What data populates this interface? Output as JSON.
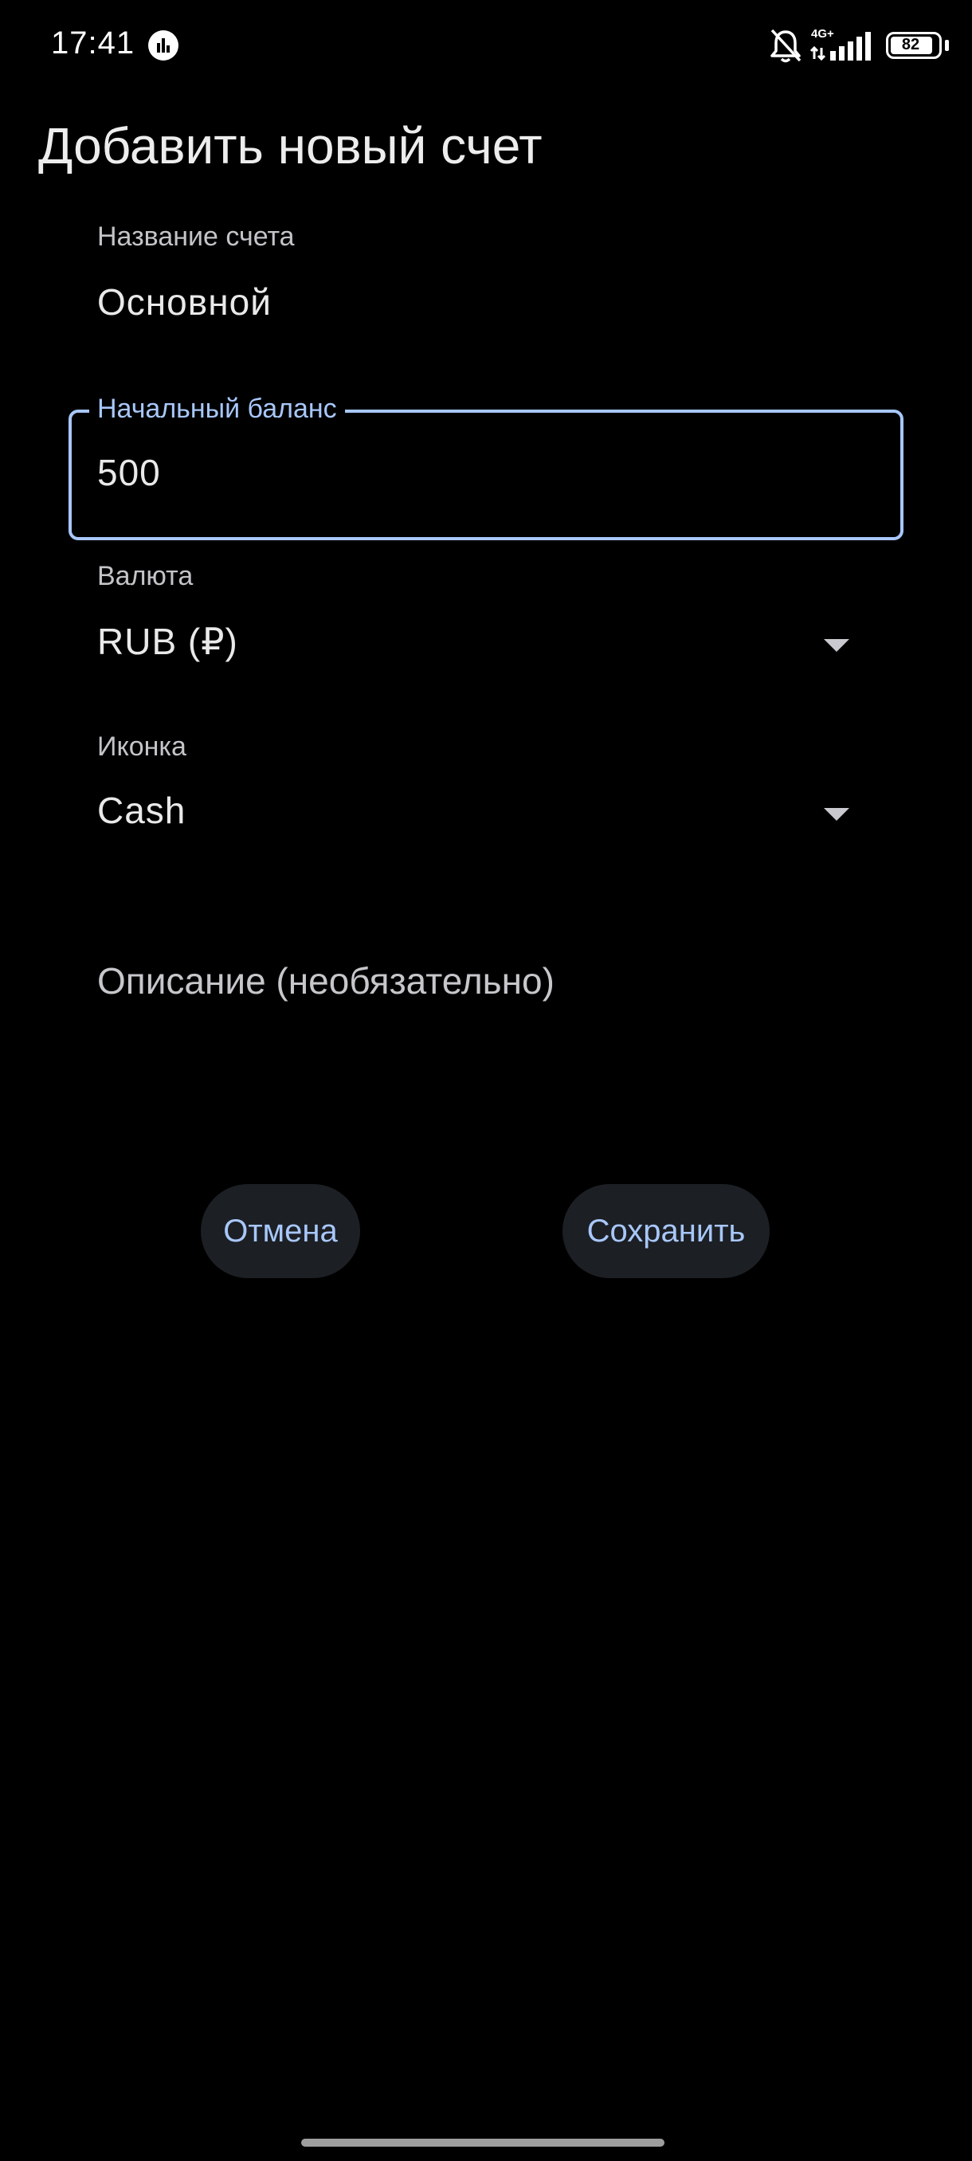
{
  "status_bar": {
    "time": "17:41",
    "app_icon": "chart-app-icon",
    "network": "4G+",
    "battery": "82",
    "icons": [
      "bell-off-icon",
      "signal-icon",
      "battery-icon"
    ]
  },
  "dialog": {
    "title": "Добавить новый счет",
    "account_name": {
      "label": "Название счета",
      "value": "Основной"
    },
    "initial_balance": {
      "label": "Начальный баланс",
      "value": "500"
    },
    "currency": {
      "label": "Валюта",
      "value": "RUB (₽)"
    },
    "icon": {
      "label": "Иконка",
      "value": "Cash"
    },
    "description": {
      "placeholder": "Описание (необязательно)"
    },
    "buttons": {
      "cancel": "Отмена",
      "save": "Сохранить"
    }
  },
  "colors": {
    "background": "#000000",
    "accent": "#a8c7fa",
    "button_bg": "#1c1f24",
    "text": "#e9e9e9",
    "label": "#c3c3c8"
  }
}
